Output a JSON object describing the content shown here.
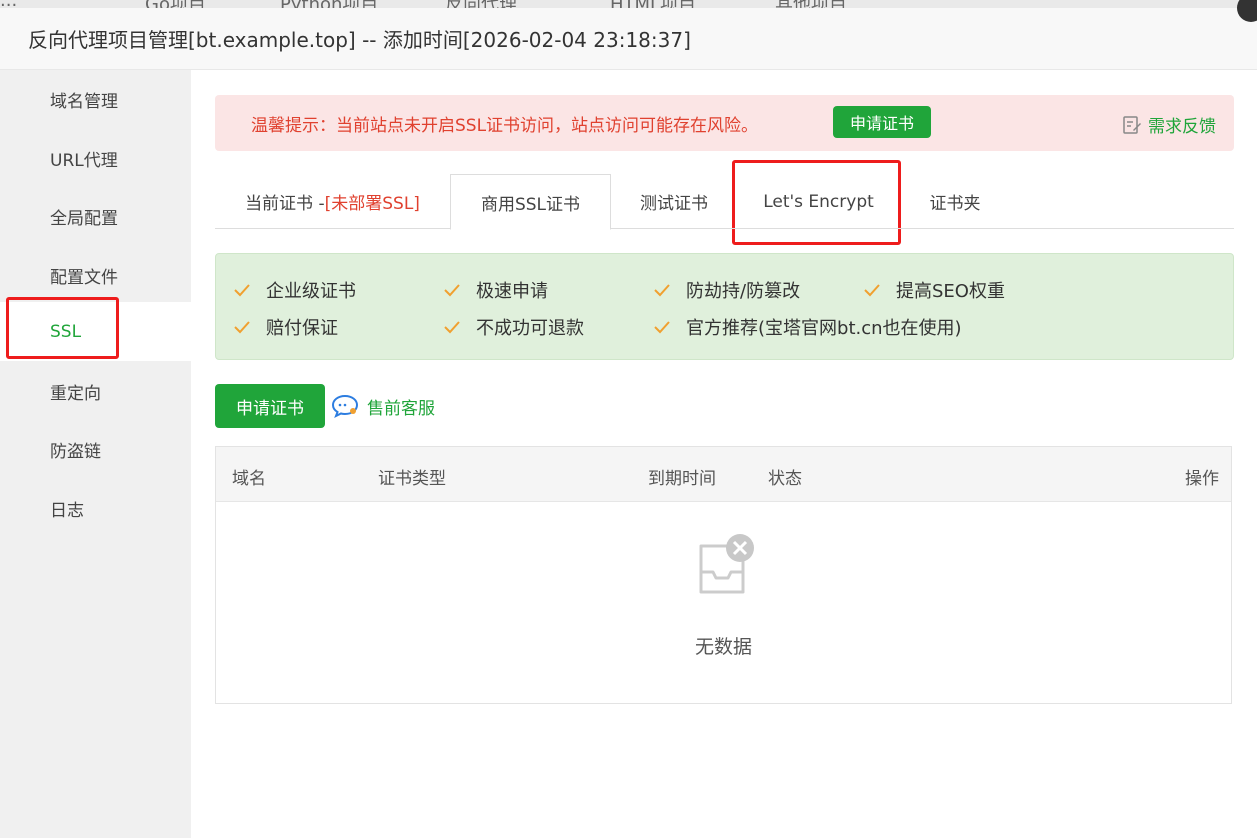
{
  "window": {
    "title": "反向代理项目管理[bt.example.top] -- 添加时间[2026-02-04 23:18:37]",
    "bg_tabs": [
      "...",
      "Go项目",
      "Python项目",
      "反向代理",
      "HTML项目",
      "其他项目"
    ]
  },
  "sidebar": {
    "items": [
      {
        "label": "域名管理"
      },
      {
        "label": "URL代理"
      },
      {
        "label": "全局配置"
      },
      {
        "label": "配置文件"
      },
      {
        "label": "SSL"
      },
      {
        "label": "重定向"
      },
      {
        "label": "防盗链"
      },
      {
        "label": "日志"
      }
    ],
    "active_index": 4
  },
  "alert": {
    "text": "温馨提示：当前站点未开启SSL证书访问，站点访问可能存在风险。",
    "button": "申请证书",
    "feedback": "需求反馈"
  },
  "tabs": {
    "current_prefix": "当前证书 -",
    "current_status": "[未部署SSL]",
    "commercial": "商用SSL证书",
    "test": "测试证书",
    "letsencrypt": "Let's Encrypt",
    "folder": "证书夹"
  },
  "features": [
    "企业级证书",
    "极速申请",
    "防劫持/防篡改",
    "提高SEO权重",
    "赔付保证",
    "不成功可退款",
    "官方推荐(宝塔官网bt.cn也在使用)"
  ],
  "actions": {
    "apply": "申请证书",
    "presale": "售前客服"
  },
  "table": {
    "columns": [
      "域名",
      "证书类型",
      "到期时间",
      "状态",
      "操作"
    ],
    "empty": "无数据"
  },
  "colors": {
    "accent": "#20a53a",
    "alert_bg": "#fbe5e5",
    "alert_text": "#e0412f",
    "highlight": "#ee1c1c",
    "check": "#f0a030"
  }
}
